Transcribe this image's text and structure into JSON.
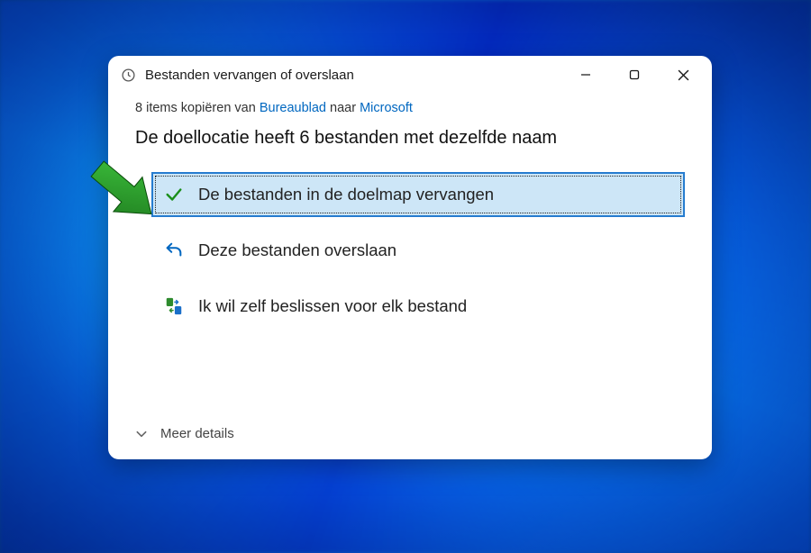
{
  "dialog": {
    "title": "Bestanden vervangen of overslaan",
    "subtitle_prefix": "8 items kopiëren van ",
    "source_link": "Bureaublad",
    "subtitle_mid": " naar ",
    "dest_link": "Microsoft",
    "heading": "De doellocatie heeft 6 bestanden met dezelfde naam",
    "options": {
      "replace": "De bestanden in de doelmap vervangen",
      "skip": "Deze bestanden overslaan",
      "decide": "Ik wil zelf beslissen voor elk bestand"
    },
    "more_details": "Meer details"
  },
  "colors": {
    "accent": "#0067c0",
    "selected_bg": "#cde6f7",
    "selected_border": "#267ccf",
    "check_green": "#1a8f1a",
    "callout_green": "#2ea52e"
  }
}
